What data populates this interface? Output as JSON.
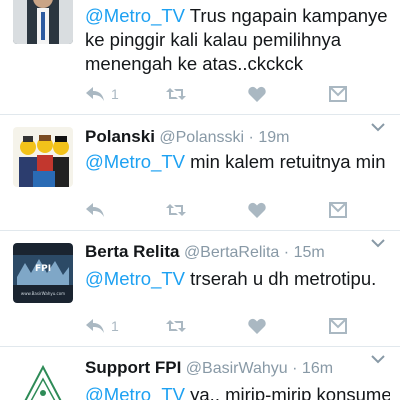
{
  "colors": {
    "link": "#1da1f2",
    "muted": "#8899a6",
    "icon": "#aab8c2",
    "divider": "#e1e8ed"
  },
  "tweets": [
    {
      "name": "",
      "handle": "",
      "time": "",
      "mention": "@Metro_TV",
      "text": " Trus ngapain kampanye ke pinggir kali kalau pemilihnya menengah ke atas..ckckck",
      "reply_count": "1",
      "avatar_icon": "person-in-suit-avatar"
    },
    {
      "name": "Polanski",
      "handle": "@Polansski",
      "time": "19m",
      "mention": "@Metro_TV",
      "text": " min kalem retuitnya min",
      "reply_count": "",
      "avatar_icon": "lego-figures-avatar"
    },
    {
      "name": "Berta Relita",
      "handle": "@BertaRelita",
      "time": "15m",
      "mention": "@Metro_TV",
      "text": " trserah u dh metrotipu.",
      "reply_count": "1",
      "avatar_icon": "dark-banner-avatar",
      "avatar_caption": "www.BasirWahyu.com"
    },
    {
      "name": "Support FPI",
      "handle": "@BasirWahyu",
      "time": "16m",
      "mention": "@Metro_TV",
      "text": " ya.. mirip-mirip konsumen",
      "reply_count": "",
      "avatar_icon": "green-triangle-logo-avatar"
    }
  ],
  "separator_dot": "·"
}
